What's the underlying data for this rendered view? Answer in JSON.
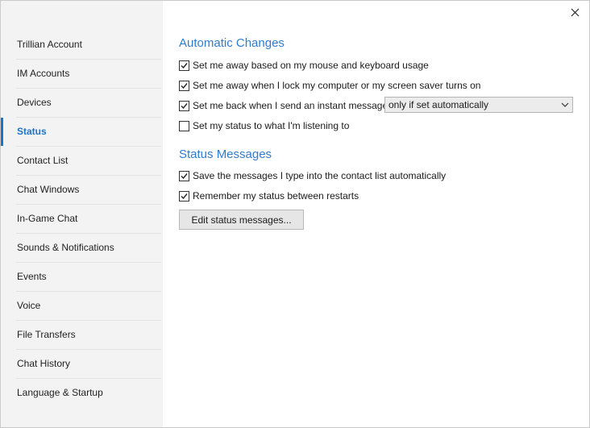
{
  "sidebar": {
    "items": [
      {
        "id": "trillian-account",
        "label": "Trillian Account"
      },
      {
        "id": "im-accounts",
        "label": "IM Accounts"
      },
      {
        "id": "devices",
        "label": "Devices"
      },
      {
        "id": "status",
        "label": "Status",
        "active": true
      },
      {
        "id": "contact-list",
        "label": "Contact List"
      },
      {
        "id": "chat-windows",
        "label": "Chat Windows"
      },
      {
        "id": "in-game-chat",
        "label": "In-Game Chat"
      },
      {
        "id": "sounds-notifications",
        "label": "Sounds & Notifications"
      },
      {
        "id": "events",
        "label": "Events"
      },
      {
        "id": "voice",
        "label": "Voice"
      },
      {
        "id": "file-transfers",
        "label": "File Transfers"
      },
      {
        "id": "chat-history",
        "label": "Chat History"
      },
      {
        "id": "language-startup",
        "label": "Language & Startup"
      }
    ]
  },
  "automatic_changes": {
    "title": "Automatic Changes",
    "options": [
      {
        "label": "Set me away based on my mouse and keyboard usage",
        "checked": true
      },
      {
        "label": "Set me away when I lock my computer or my screen saver turns on",
        "checked": true
      },
      {
        "label": "Set me back when I send an instant message",
        "checked": true
      },
      {
        "label": "Set my status to what I'm listening to",
        "checked": false
      }
    ],
    "back_condition": {
      "selected": "only if set automatically"
    }
  },
  "status_messages": {
    "title": "Status Messages",
    "options": [
      {
        "label": "Save the messages I type into the contact list automatically",
        "checked": true
      },
      {
        "label": "Remember my status between restarts",
        "checked": true
      }
    ],
    "edit_button_label": "Edit status messages..."
  },
  "colors": {
    "accent": "#1e74c4",
    "section_title": "#2f7ccf",
    "sidebar_bg": "#f3f3f3"
  },
  "icons": {
    "close": "close-icon",
    "check": "check-icon",
    "dropdown": "chevron-down-icon"
  }
}
